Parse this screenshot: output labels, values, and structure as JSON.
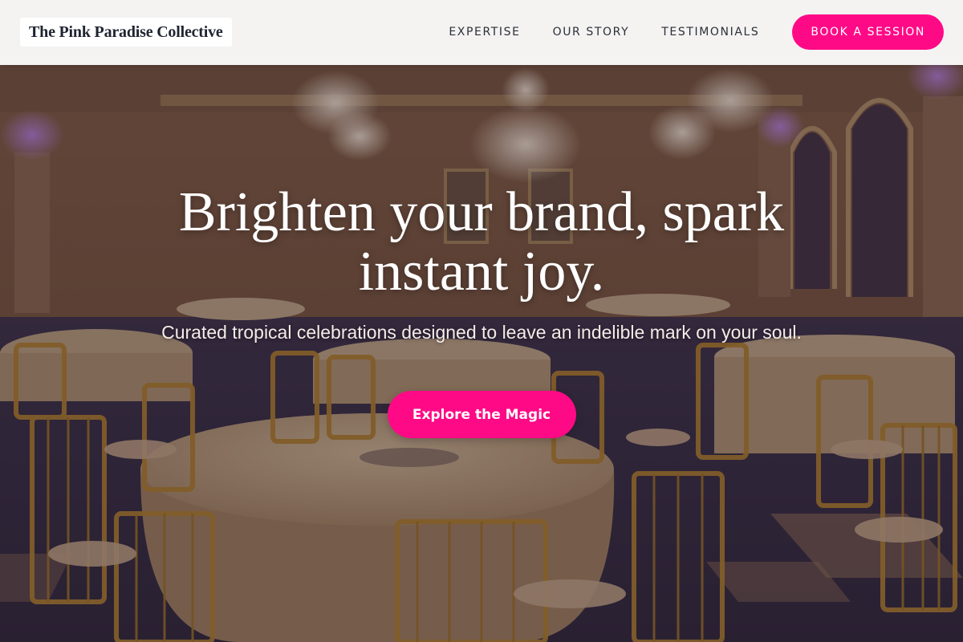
{
  "header": {
    "logo_text": "The Pink Paradise Collective",
    "nav": [
      {
        "label": "EXPERTISE"
      },
      {
        "label": "OUR STORY"
      },
      {
        "label": "TESTIMONIALS"
      }
    ],
    "cta_label": "BOOK A SESSION"
  },
  "hero": {
    "title": "Brighten your brand, spark instant joy.",
    "subtitle": "Curated tropical celebrations designed to leave an indelible mark on your soul.",
    "button_label": "Explore the Magic",
    "background_image": "ballroom-banquet-hall-photo"
  },
  "colors": {
    "accent": "#ff0a86",
    "header_bg": "#fafafa",
    "text_dark": "#2b2f38",
    "hero_text": "#ffffff"
  }
}
